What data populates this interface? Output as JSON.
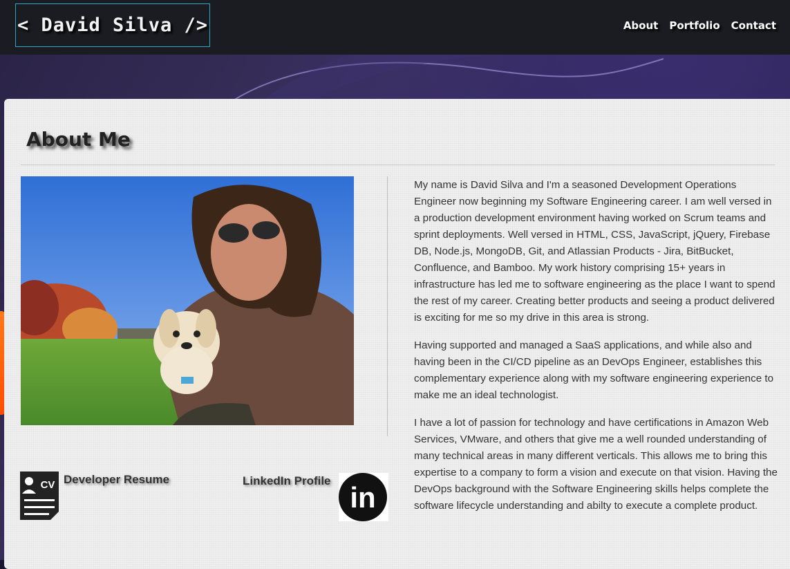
{
  "header": {
    "logo": "< David Silva />",
    "nav": [
      "About",
      "Portfolio",
      "Contact"
    ]
  },
  "about": {
    "title": "About Me",
    "paragraphs": [
      "My name is David Silva and I'm a seasoned Development Operations Engineer now beginning my Software Engineering career. I am well versed in a production development environment having worked on Scrum teams and sprint deployments. Well versed in HTML, CSS, JavaScript, jQuery, Firebase DB, Node.js, MongoDB, Git, and Atlassian Products - Jira, BitBucket, Confluence, and Bamboo. My work history comprising 15+ years in infrastructure has led me to software engineering as the place I want to spend the rest of my career. Creating better products and seeing a product delivered is exciting for me so my drive in this area is strong.",
      "Having supported and managed a SaaS applications, and while also and having been in the CI/CD pipeline as an DevOps Engineer, establishes this complementary experience along with my software engineering experience to make me an ideal technologist.",
      "I have a lot of passion for technology and have certifications in Amazon Web Services, VMware, and others that give me a well rounded understanding of many technical areas in many different verticals. This allows me to bring this expertise to a company to form a vision and execute on that vision. Having the DevOps background with the Software Engineering skills helps complete the software lifecycle understanding and abilty to execute a complete product."
    ]
  },
  "links": {
    "resume_label": "Developer Resume",
    "resume_icon_text": "CV",
    "linkedin_label": "LinkedIn Profile",
    "linkedin_icon_text": "in"
  },
  "icons": {
    "resume": "resume-cv-icon",
    "linkedin": "linkedin-icon"
  },
  "colors": {
    "header_bg": "#1b1c22",
    "logo_border": "#2aa8c4",
    "card_bg": "#efefef",
    "text": "#333333"
  }
}
